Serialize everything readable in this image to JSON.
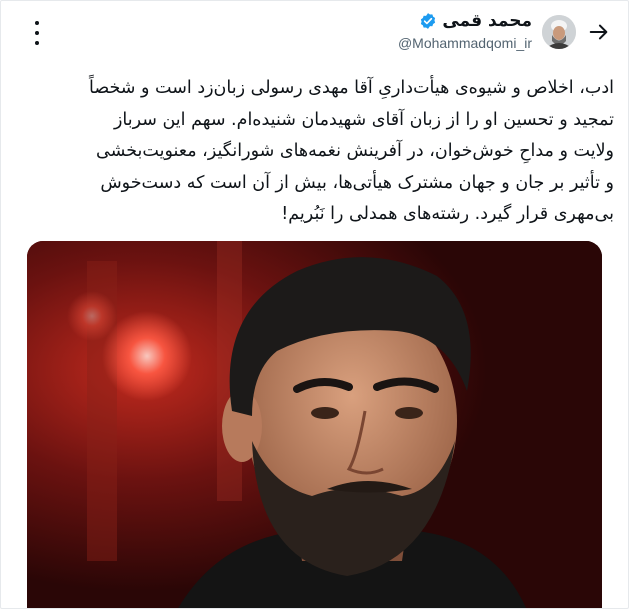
{
  "tweet": {
    "author": {
      "display_name": "محمد قمی",
      "handle": "@Mohammadqomi_ir",
      "verified": true,
      "verified_color": "#1d9bf0"
    },
    "text": "ادب، اخلاص و شیوه‌ی هیأت‌داریِ آقا مهدی رسولی زبان‌زد است و شخصاً\nتمجید و تحسین او را از زبان آقای شهیدمان شنیده‌ام. سهم این سرباز\nولایت و مداحِ خوش‌خوان، در آفرینش نغمه‌های شورانگیز، معنویت‌بخشی\nو تأثیر بر جان و جهان مشترک هیأتی‌ها، بیش از آن است که دست‌خوش\nبی‌مهری قرار گیرد. رشته‌های همدلی را نَبُریم!",
    "media": {
      "type": "photo",
      "background_color": "#3a0a0a"
    }
  },
  "icons": {
    "back": "arrow-right-icon",
    "more": "more-vertical-icon",
    "verified": "verified-badge-icon"
  }
}
